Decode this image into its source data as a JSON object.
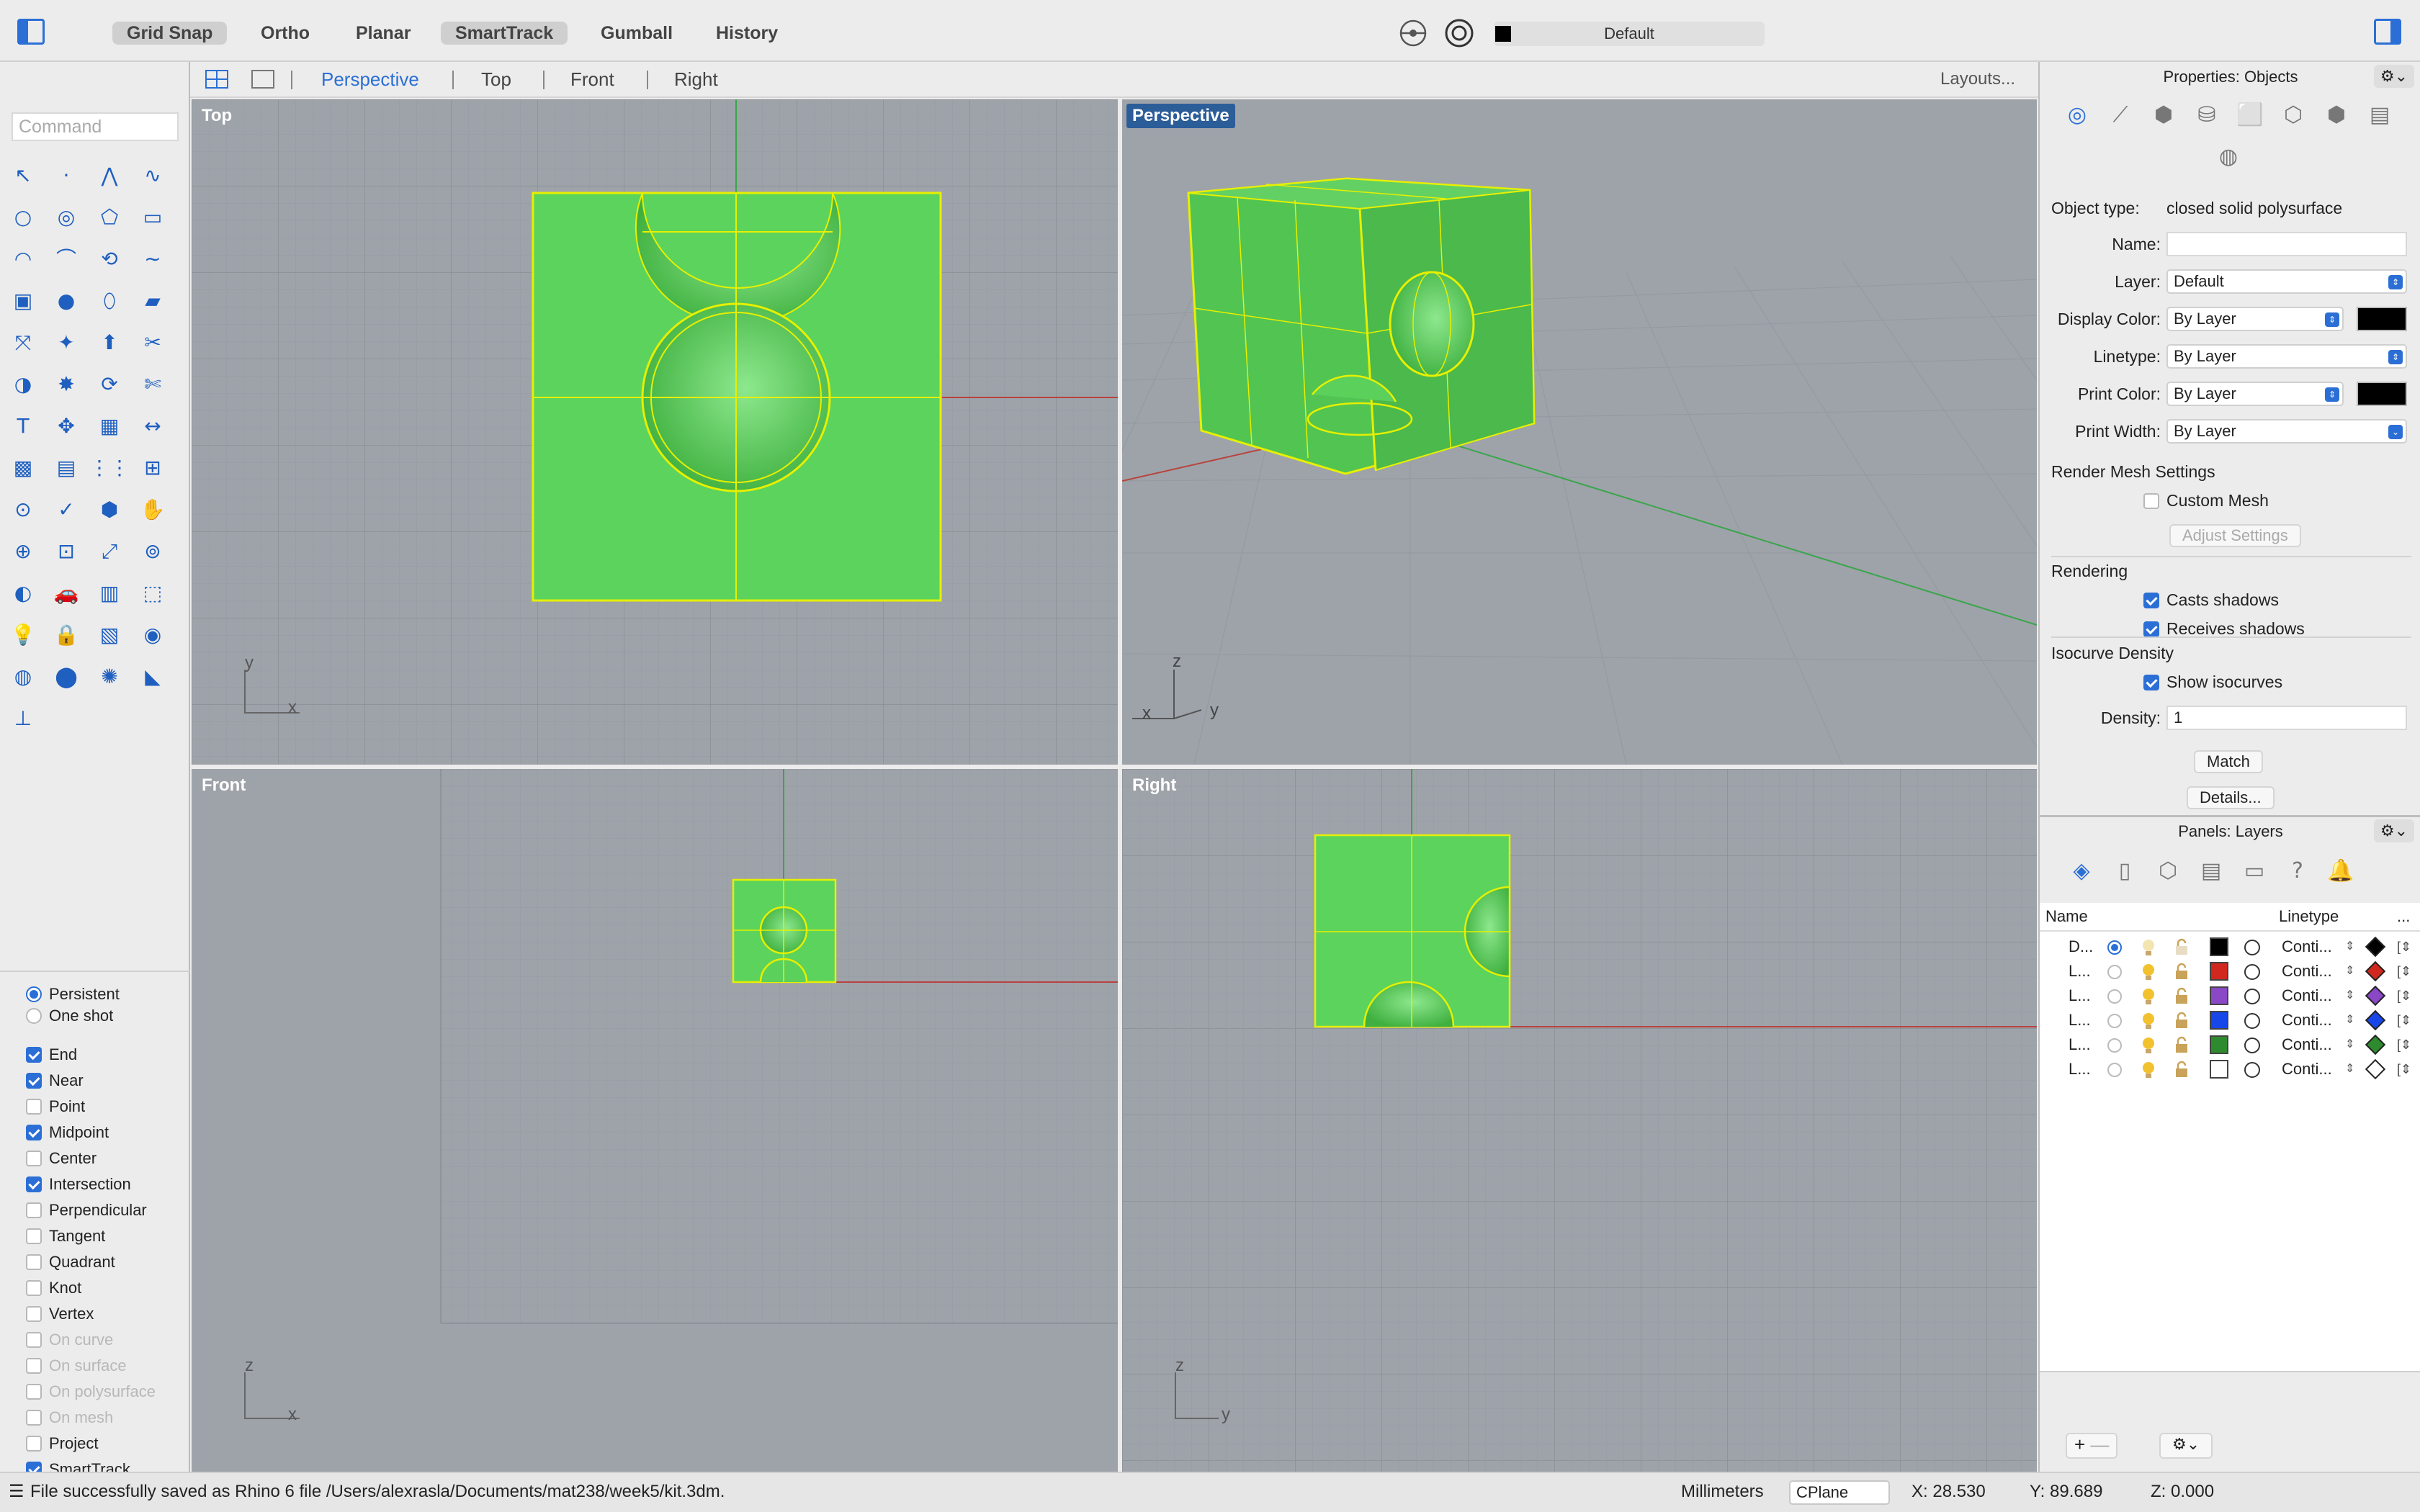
{
  "toolbar": {
    "modes": [
      {
        "label": "Grid Snap",
        "active": true
      },
      {
        "label": "Ortho",
        "active": false
      },
      {
        "label": "Planar",
        "active": false
      },
      {
        "label": "SmartTrack",
        "active": true
      },
      {
        "label": "Gumball",
        "active": false
      },
      {
        "label": "History",
        "active": false
      }
    ],
    "layer_name": "Default"
  },
  "viewport_tabs": {
    "active": "Perspective",
    "tabs": [
      "Perspective",
      "Top",
      "Front",
      "Right"
    ],
    "layouts_label": "Layouts..."
  },
  "command": {
    "placeholder": "Command"
  },
  "tool_icons": [
    "pointer-icon",
    "point-icon",
    "polyline-icon",
    "curve-icon",
    "circle-icon",
    "ellipse-icon",
    "polygon-icon",
    "rectangle-icon",
    "arc-icon",
    "fillet-icon",
    "offset-icon",
    "curve-tools-icon",
    "box-icon",
    "sphere-icon",
    "cylinder-icon",
    "surface-icon",
    "transform-icon",
    "solid-tools-icon",
    "extrude-icon",
    "split-icon",
    "boolean-icon",
    "explode-icon",
    "rebuild-icon",
    "trim-icon",
    "text-icon",
    "move-icon",
    "array-icon",
    "dimension-icon",
    "mesh-icon",
    "blocks-icon",
    "grid-array-icon",
    "align-icon",
    "analyze-icon",
    "check-icon",
    "group-icon",
    "pan-icon",
    "zoom-icon",
    "zoom-window-icon",
    "zoom-extents-icon",
    "zoom-selected-icon",
    "view-icon",
    "render-icon",
    "car-icon",
    "snapshot-icon",
    "light-icon",
    "lock-icon",
    "layer-icon",
    "color-wheel-icon",
    "sphere-view-icon",
    "material-icon",
    "gear-sphere-icon",
    "cone-light-icon",
    "cplane-icon"
  ],
  "osnap": {
    "mode": [
      {
        "label": "Persistent",
        "selected": true
      },
      {
        "label": "One shot",
        "selected": false
      }
    ],
    "items": [
      {
        "label": "End",
        "checked": true,
        "enabled": true
      },
      {
        "label": "Near",
        "checked": true,
        "enabled": true
      },
      {
        "label": "Point",
        "checked": false,
        "enabled": true
      },
      {
        "label": "Midpoint",
        "checked": true,
        "enabled": true
      },
      {
        "label": "Center",
        "checked": false,
        "enabled": true
      },
      {
        "label": "Intersection",
        "checked": true,
        "enabled": true
      },
      {
        "label": "Perpendicular",
        "checked": false,
        "enabled": true
      },
      {
        "label": "Tangent",
        "checked": false,
        "enabled": true
      },
      {
        "label": "Quadrant",
        "checked": false,
        "enabled": true
      },
      {
        "label": "Knot",
        "checked": false,
        "enabled": true
      },
      {
        "label": "Vertex",
        "checked": false,
        "enabled": true
      },
      {
        "label": "On curve",
        "checked": false,
        "enabled": false
      },
      {
        "label": "On surface",
        "checked": false,
        "enabled": false
      },
      {
        "label": "On polysurface",
        "checked": false,
        "enabled": false
      },
      {
        "label": "On mesh",
        "checked": false,
        "enabled": false
      },
      {
        "label": "Project",
        "checked": false,
        "enabled": true
      },
      {
        "label": "SmartTrack",
        "checked": true,
        "enabled": true
      }
    ]
  },
  "viewports": {
    "top": {
      "title": "Top",
      "axis_a": "y",
      "axis_b": "x"
    },
    "perspective": {
      "title": "Perspective",
      "axis_a": "z",
      "axis_b": "x",
      "axis_c": "y"
    },
    "front": {
      "title": "Front",
      "axis_a": "z",
      "axis_b": "x"
    },
    "right": {
      "title": "Right",
      "axis_a": "z",
      "axis_b": "y"
    }
  },
  "properties": {
    "header": "Properties: Objects",
    "gear_label": "⚙︎⌄",
    "icons": [
      "object-icon",
      "curve-prop-icon",
      "material-prop-icon",
      "mesh-prop-icon",
      "decal-icon",
      "texture-map-icon",
      "cube-prop-icon",
      "document-icon",
      "sphere-prop-icon"
    ],
    "object_type_label": "Object type:",
    "object_type": "closed solid polysurface",
    "name_label": "Name:",
    "name_value": "",
    "layer_label": "Layer:",
    "layer_value": "Default",
    "display_color_label": "Display Color:",
    "display_color_value": "By Layer",
    "linetype_label": "Linetype:",
    "linetype_value": "By Layer",
    "print_color_label": "Print Color:",
    "print_color_value": "By Layer",
    "print_width_label": "Print Width:",
    "print_width_value": "By Layer",
    "render_mesh_label": "Render Mesh Settings",
    "custom_mesh_label": "Custom Mesh",
    "custom_mesh_checked": false,
    "adjust_settings_label": "Adjust Settings",
    "rendering_label": "Rendering",
    "casts_shadows_label": "Casts shadows",
    "casts_shadows_checked": true,
    "receives_shadows_label": "Receives shadows",
    "receives_shadows_checked": true,
    "isocurve_label": "Isocurve Density",
    "show_isocurves_label": "Show isocurves",
    "show_isocurves_checked": true,
    "density_label": "Density:",
    "density_value": "1",
    "match_label": "Match",
    "details_label": "Details..."
  },
  "layers": {
    "header": "Panels: Layers",
    "gear_label": "⚙︎⌄",
    "icons": [
      "layers-tab-icon",
      "document-tab-icon",
      "cube-tab-icon",
      "notes-tab-icon",
      "display-tab-icon",
      "help-tab-icon",
      "notification-tab-icon"
    ],
    "col_name": "Name",
    "col_linetype": "Linetype",
    "col_more": "...",
    "rows": [
      {
        "name": "D...",
        "current": true,
        "color": "#000000",
        "linetype": "Conti...",
        "print_color": "#000000"
      },
      {
        "name": "L...",
        "current": false,
        "color": "#d0281e",
        "linetype": "Conti...",
        "print_color": "#d0281e"
      },
      {
        "name": "L...",
        "current": false,
        "color": "#8a47c6",
        "linetype": "Conti...",
        "print_color": "#8a47c6"
      },
      {
        "name": "L...",
        "current": false,
        "color": "#1747e8",
        "linetype": "Conti...",
        "print_color": "#1747e8"
      },
      {
        "name": "L...",
        "current": false,
        "color": "#2e8a2e",
        "linetype": "Conti...",
        "print_color": "#2e8a2e"
      },
      {
        "name": "L...",
        "current": false,
        "color": "#ffffff",
        "linetype": "Conti...",
        "print_color": "#ffffff"
      }
    ],
    "add_label": "+",
    "remove_label": "—",
    "bottom_gear_label": "⚙︎⌄"
  },
  "status": {
    "message": "File successfully saved as Rhino 6 file /Users/alexrasla/Documents/mat238/week5/kit.3dm.",
    "units": "Millimeters",
    "cplane": "CPlane",
    "x": "X: 28.530",
    "y": "Y: 89.689",
    "z": "Z: 0.000"
  },
  "colors": {
    "accent": "#2b6fd6",
    "object_fill": "#5cd35c",
    "object_edge": "#e6f000",
    "viewport_bg": "#9ea3aa",
    "x_axis": "#b8433d",
    "y_axis": "#3aa54a"
  }
}
